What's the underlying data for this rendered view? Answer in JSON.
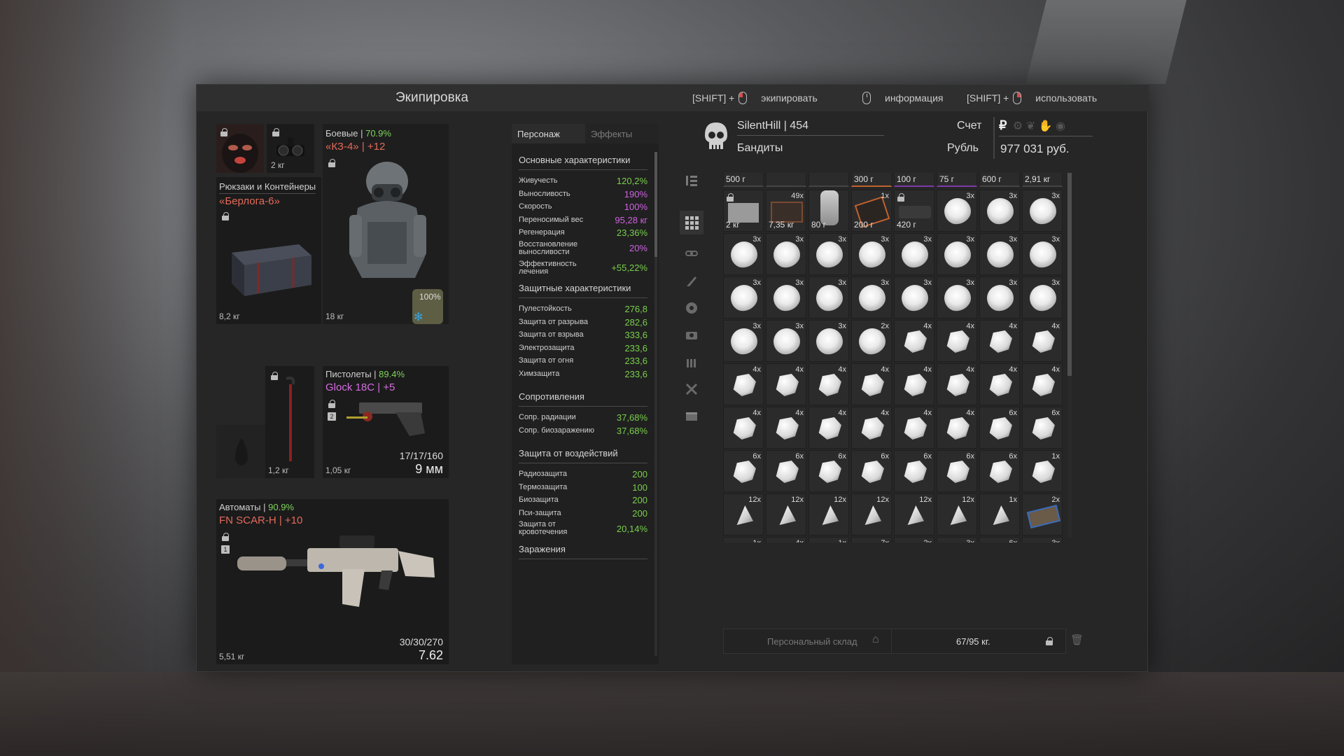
{
  "header": {
    "title": "Экипировка",
    "hints": [
      {
        "prefix": "[SHIFT] +",
        "label": "экипировать"
      },
      {
        "prefix": "",
        "label": "информация"
      },
      {
        "prefix": "[SHIFT] +",
        "label": "использовать"
      }
    ]
  },
  "equipment": {
    "face_weight": "2 кг",
    "backpack": {
      "category": "Рюкзаки и Контейнеры",
      "name": "«Берлога-6»",
      "weight": "8,2 кг"
    },
    "armor": {
      "category": "Боевые",
      "percent": "70.9%",
      "name": "«КЗ-4» | +12",
      "weight": "18 кг",
      "module_percent": "100%"
    },
    "knife_weight": "1,2 кг",
    "pistol": {
      "category": "Пистолеты",
      "percent": "89.4%",
      "name": "Glock 18C | +5",
      "weight": "1,05 кг",
      "ammo": "17/17/160",
      "caliber": "9 мм",
      "slot_number": "2"
    },
    "rifle": {
      "category": "Автоматы",
      "percent": "90.9%",
      "name": "FN SCAR-H | +10",
      "weight": "5,51 кг",
      "ammo": "30/30/270",
      "caliber": "7.62",
      "slot_number": "1"
    }
  },
  "stats": {
    "tabs": [
      "Персонаж",
      "Эффекты"
    ],
    "sections": [
      {
        "title": "Основные характеристики",
        "rows": [
          {
            "name": "Живучесть",
            "value": "120,2%",
            "color": "green"
          },
          {
            "name": "Выносливость",
            "value": "190%",
            "color": "purple"
          },
          {
            "name": "Скорость",
            "value": "100%",
            "color": "purple"
          },
          {
            "name": "Переносимый вес",
            "value": "95,28 кг",
            "color": "purple"
          },
          {
            "name": "Регенерация",
            "value": "23,36%",
            "color": "green"
          },
          {
            "name": "Восстановление выносливости",
            "value": "20%",
            "color": "purple"
          },
          {
            "name": "Эффективность лечения",
            "value": "+55,22%",
            "color": "green"
          }
        ]
      },
      {
        "title": "Защитные характеристики",
        "rows": [
          {
            "name": "Пулестойкость",
            "value": "276,8",
            "color": "green"
          },
          {
            "name": "Защита от разрыва",
            "value": "282,6",
            "color": "green"
          },
          {
            "name": "Защита от взрыва",
            "value": "333,6",
            "color": "green"
          },
          {
            "name": "Электрозащита",
            "value": "233,6",
            "color": "green"
          },
          {
            "name": "Защита от огня",
            "value": "233,6",
            "color": "green"
          },
          {
            "name": "Химзащита",
            "value": "233,6",
            "color": "green"
          }
        ]
      },
      {
        "title": "Сопротивления",
        "rows": [
          {
            "name": "Сопр. радиации",
            "value": "37,68%",
            "color": "green"
          },
          {
            "name": "Сопр. биозаражению",
            "value": "37,68%",
            "color": "green"
          }
        ]
      },
      {
        "title": "Защита от воздействий",
        "rows": [
          {
            "name": "Радиозащита",
            "value": "200",
            "color": "green"
          },
          {
            "name": "Термозащита",
            "value": "100",
            "color": "green"
          },
          {
            "name": "Биозащита",
            "value": "200",
            "color": "green"
          },
          {
            "name": "Пси-защита",
            "value": "200",
            "color": "green"
          },
          {
            "name": "Защита от кровотечения",
            "value": "20,14%",
            "color": "green"
          }
        ]
      },
      {
        "title": "Заражения",
        "rows": []
      }
    ]
  },
  "profile": {
    "name": "SilentHill | 454",
    "faction": "Бандиты",
    "account_label": "Счет",
    "currency_label": "Рубль",
    "balance": "977 031 руб.",
    "currency_symbol": "₽"
  },
  "inventory": {
    "top_weights": [
      "500 г",
      "",
      "",
      "300 г",
      "100 г",
      "75 г",
      "600 г",
      "2,91 кг"
    ],
    "first_row": [
      {
        "count": "",
        "weight": "2 кг",
        "kind": "box"
      },
      {
        "count": "49x",
        "weight": "7,35 кг",
        "kind": "case"
      },
      {
        "count": "",
        "weight": "80 г",
        "kind": "bag"
      },
      {
        "count": "1x",
        "weight": "200 г",
        "kind": "device"
      },
      {
        "count": "",
        "weight": "420 г",
        "kind": "gun"
      },
      {
        "count": "3x",
        "weight": "",
        "kind": "puff"
      },
      {
        "count": "3x",
        "weight": "",
        "kind": "puff"
      },
      {
        "count": "3x",
        "weight": "",
        "kind": "puff"
      }
    ],
    "rows": [
      [
        [
          "3x",
          "puff"
        ],
        [
          "3x",
          "puff"
        ],
        [
          "3x",
          "puff"
        ],
        [
          "3x",
          "puff"
        ],
        [
          "3x",
          "puff"
        ],
        [
          "3x",
          "puff"
        ],
        [
          "3x",
          "puff"
        ],
        [
          "3x",
          "puff"
        ]
      ],
      [
        [
          "3x",
          "puff"
        ],
        [
          "3x",
          "puff"
        ],
        [
          "3x",
          "puff"
        ],
        [
          "3x",
          "puff"
        ],
        [
          "3x",
          "puff"
        ],
        [
          "3x",
          "puff"
        ],
        [
          "3x",
          "puff"
        ],
        [
          "3x",
          "puff"
        ]
      ],
      [
        [
          "3x",
          "puff"
        ],
        [
          "3x",
          "puff"
        ],
        [
          "3x",
          "puff"
        ],
        [
          "2x",
          "puff"
        ],
        [
          "4x",
          "rock"
        ],
        [
          "4x",
          "rock"
        ],
        [
          "4x",
          "rock"
        ],
        [
          "4x",
          "rock"
        ]
      ],
      [
        [
          "4x",
          "rock"
        ],
        [
          "4x",
          "rock"
        ],
        [
          "4x",
          "rock"
        ],
        [
          "4x",
          "rock"
        ],
        [
          "4x",
          "rock"
        ],
        [
          "4x",
          "rock"
        ],
        [
          "4x",
          "rock"
        ],
        [
          "4x",
          "rock"
        ]
      ],
      [
        [
          "4x",
          "rock"
        ],
        [
          "4x",
          "rock"
        ],
        [
          "4x",
          "rock"
        ],
        [
          "4x",
          "rock"
        ],
        [
          "4x",
          "rock"
        ],
        [
          "4x",
          "rock"
        ],
        [
          "6x",
          "rock"
        ],
        [
          "6x",
          "rock"
        ]
      ],
      [
        [
          "6x",
          "rock"
        ],
        [
          "6x",
          "rock"
        ],
        [
          "6x",
          "rock"
        ],
        [
          "6x",
          "rock"
        ],
        [
          "6x",
          "rock"
        ],
        [
          "6x",
          "rock"
        ],
        [
          "6x",
          "rock"
        ],
        [
          "1x",
          "rock"
        ]
      ],
      [
        [
          "12x",
          "shard"
        ],
        [
          "12x",
          "shard"
        ],
        [
          "12x",
          "shard"
        ],
        [
          "12x",
          "shard"
        ],
        [
          "12x",
          "shard"
        ],
        [
          "12x",
          "shard"
        ],
        [
          "1x",
          "shard"
        ],
        [
          "2x",
          "crate"
        ]
      ],
      [
        [
          "1x",
          "puff"
        ],
        [
          "4x",
          "puff"
        ],
        [
          "1x",
          "puff"
        ],
        [
          "7x",
          "puff"
        ],
        [
          "2x",
          "puff"
        ],
        [
          "3x",
          "puff"
        ],
        [
          "6x",
          "puff"
        ],
        [
          "3x",
          "puff"
        ]
      ]
    ],
    "storage_label": "Персональный склад",
    "capacity": "67/95 кг."
  }
}
